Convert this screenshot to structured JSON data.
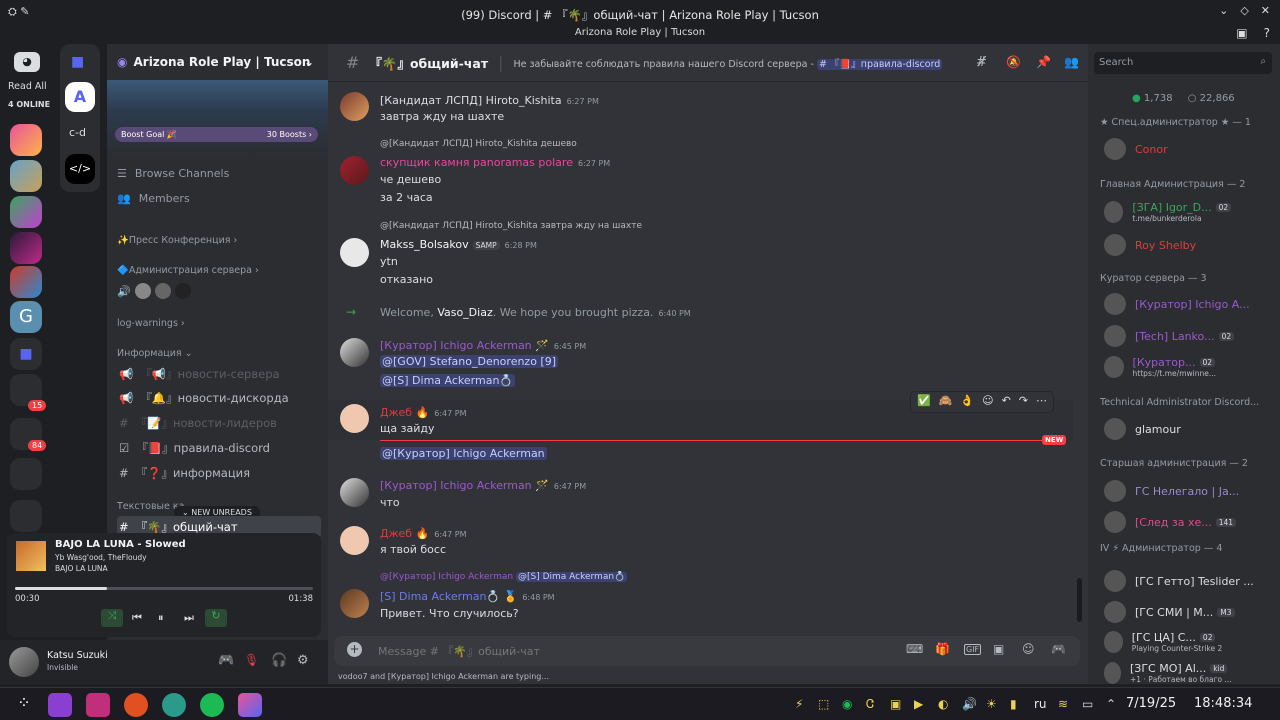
{
  "window": {
    "title": "(99) Discord | # 『🌴』общий-чат | Arizona Role Play | Tucson",
    "subtitle": "Arizona Role Play | Tucson"
  },
  "guild_rail": {
    "read_all": "Read All",
    "online": "4 ONLINE",
    "folder_label": "c-d",
    "badges": [
      "15",
      "84"
    ]
  },
  "server": {
    "name": "Arizona Role Play | Tucson",
    "boost_goal": "Boost Goal 🎉",
    "boost_count": "30 Boosts ›",
    "browse": "Browse Channels",
    "members": "Members",
    "cat_press": "✨Пресс Конференция ›",
    "cat_admin": "🔷Администрация сервера ›",
    "log_warnings": "log-warnings ›",
    "cat_info": "Информация ⌄",
    "channels": [
      {
        "name": "『📢』новости-сервера"
      },
      {
        "name": "『🔔』новости-дискорда"
      },
      {
        "name": "『📝』новости-лидеров"
      },
      {
        "name": "『📕』правила-discord"
      },
      {
        "name": "『❓』информация"
      }
    ],
    "cat_text": "Текстовые ка",
    "new_unreads": "⌄ NEW UNREADS",
    "active_channel": "『🌴』общий-чат"
  },
  "player": {
    "track": "BAJO LA LUNA - Slowed",
    "artists": "Yb Wasg'ood, TheFloudy",
    "album": "BAJO LA LUNA",
    "elapsed": "00:30",
    "total": "01:38",
    "progress": 0.31
  },
  "user": {
    "name": "Katsu Suzuki",
    "status": "Invisible"
  },
  "chat": {
    "channel": "『🌴』общий-чат",
    "topic": "Не забывайте соблюдать правила нашего Discord сервера -",
    "topic_link": "# 『📕』правила-discord",
    "messages": [
      {
        "author": "[Кандидат ЛСПД] Hiroto_Kishita",
        "time": "6:27 PM",
        "lines": [
          "завтра жду на шахте"
        ],
        "color": "#dbdee1"
      },
      {
        "reply": "@[Кандидат ЛСПД] Hiroto_Kishita дешево",
        "author": "скупщик камня panoramas polare",
        "time": "6:27 PM",
        "lines": [
          "че дешево",
          "за 2 часа"
        ],
        "color": "#eb459e"
      },
      {
        "reply": "@[Кандидат ЛСПД] Hiroto_Kishita завтра жду на шахте",
        "author": "Makss_Bolsakov",
        "tag": "SAMP",
        "time": "6:28 PM",
        "lines": [
          "ytn",
          "отказано"
        ],
        "color": "#f2f3f5"
      },
      {
        "system": "Welcome, ",
        "system_user": "Vaso_Diaz",
        "system_tail": ". We hope you brought pizza.",
        "time": "6:40 PM"
      },
      {
        "author": "[Куратор] Ichigo Ackerman 🪄",
        "time": "6:45 PM",
        "lines": [
          "@[GOV] Stefano_Denorenzo [9]",
          "@[S] Dima Ackerman💍"
        ],
        "color": "#9b59d0"
      },
      {
        "author": "Джеб 🔥",
        "time": "6:47 PM",
        "lines": [
          "ща зайду"
        ],
        "color": "#e03c3c"
      },
      {
        "lines": [
          "@[Куратор] Ichigo Ackerman"
        ]
      },
      {
        "author": "[Куратор] Ichigo Ackerman 🪄",
        "time": "6:47 PM",
        "lines": [
          "что"
        ],
        "color": "#9b59d0"
      },
      {
        "author": "Джеб 🔥",
        "time": "6:47 PM",
        "lines": [
          "я твой босс"
        ],
        "color": "#e03c3c"
      },
      {
        "reply": "@[Куратор] Ichigo Ackerman",
        "reply2": "@[S] Dima Ackerman💍",
        "author": "[S] Dima Ackerman💍 🏅",
        "time": "6:48 PM",
        "lines": [
          "Привет. Что случилось?"
        ],
        "color": "#5865f2"
      }
    ],
    "new_label": "NEW",
    "placeholder": "Message # 『🌴』общий-чат",
    "typing": "vodoo7 and [Куратор] Ichigo Ackerman are typing..."
  },
  "members_panel": {
    "search": "Search",
    "online": "1,738",
    "total": "22,866",
    "groups": [
      {
        "title": "★ Спец.администратор ★ — 1",
        "members": [
          {
            "name": "Conor",
            "color": "#e03c3c"
          }
        ]
      },
      {
        "title": "Главная Администрация — 2",
        "members": [
          {
            "name": "[ЗГА] Igor_D...",
            "sub": "t.me/bunkerderola",
            "color": "#3ba55d",
            "badge": "02"
          },
          {
            "name": "Roy Shelby",
            "color": "#e03c3c"
          }
        ]
      },
      {
        "title": "Куратор сервера — 3",
        "members": [
          {
            "name": "[Куратор] Ichigo A...",
            "color": "#9b59d0"
          },
          {
            "name": "[Tech] Lanko...",
            "color": "#9b59d0",
            "badge": "02"
          },
          {
            "name": "[Куратор...",
            "sub": "https://t.me/mwinne...",
            "color": "#9b59d0",
            "badge": "02"
          }
        ]
      },
      {
        "title": "Technical Administrator Discord...",
        "members": [
          {
            "name": "glamour",
            "color": "#dbdee1"
          }
        ]
      },
      {
        "title": "Старшая администрация — 2",
        "members": [
          {
            "name": "ГС Нелегало | Ja...",
            "color": "#9a8ad0"
          },
          {
            "name": "[След за хе...",
            "color": "#e04b8c",
            "badge": "141"
          }
        ]
      },
      {
        "title": "IV ⚡ Администратор — 4",
        "members": [
          {
            "name": "[ГС Гетто] Teslider ...",
            "color": "#dbdee1"
          },
          {
            "name": "[ГС СМИ | М...",
            "color": "#dbdee1",
            "badge": "M3"
          },
          {
            "name": "[ГС ЦА] С...",
            "sub": "Playing Counter-Strike 2",
            "color": "#dbdee1",
            "badge": "02"
          },
          {
            "name": "[ЗГС МО] Al...",
            "sub": "+1 · Работаем во благо ...",
            "color": "#dbdee1",
            "badge": "kid"
          }
        ]
      }
    ]
  },
  "taskbar": {
    "lang": "ru",
    "date": "7/19/25",
    "time": "18:48:34"
  }
}
